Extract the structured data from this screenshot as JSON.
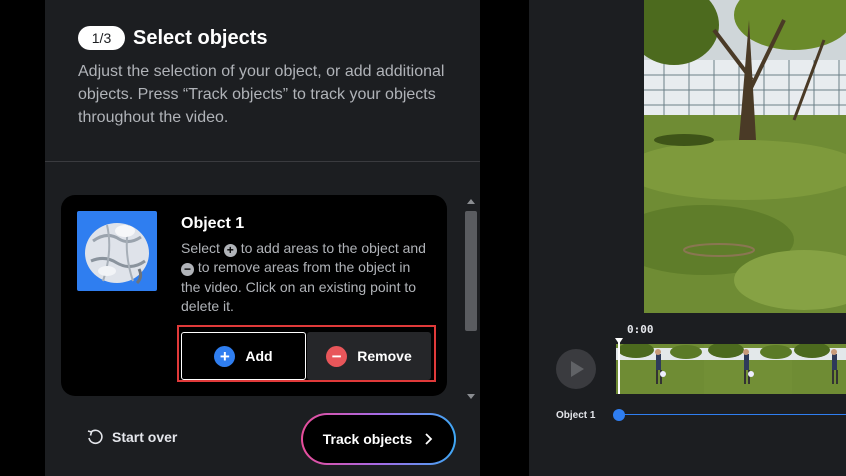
{
  "header": {
    "step_badge": "1/3",
    "title": "Select objects",
    "description": "Adjust the selection of your object, or add additional objects. Press “Track objects” to track your objects throughout the video."
  },
  "object_card": {
    "name": "Object 1",
    "instructions": {
      "part1": "Select",
      "part2": "to add areas to the object and",
      "part3": "to remove areas from the object in the video. Click on an existing point to delete it."
    },
    "add_label": "Add",
    "remove_label": "Remove"
  },
  "footer": {
    "start_over_label": "Start over",
    "track_label": "Track objects"
  },
  "timeline": {
    "time": "0:00",
    "track_label": "Object 1"
  },
  "colors": {
    "accent_blue": "#2f7ef0",
    "remove_red": "#e8565a",
    "highlight_red": "#e03a3a"
  },
  "icons": {
    "add": "plus-circle-icon",
    "remove": "minus-circle-icon",
    "start_over": "undo-icon",
    "track": "chevron-right-icon",
    "play": "play-icon"
  }
}
